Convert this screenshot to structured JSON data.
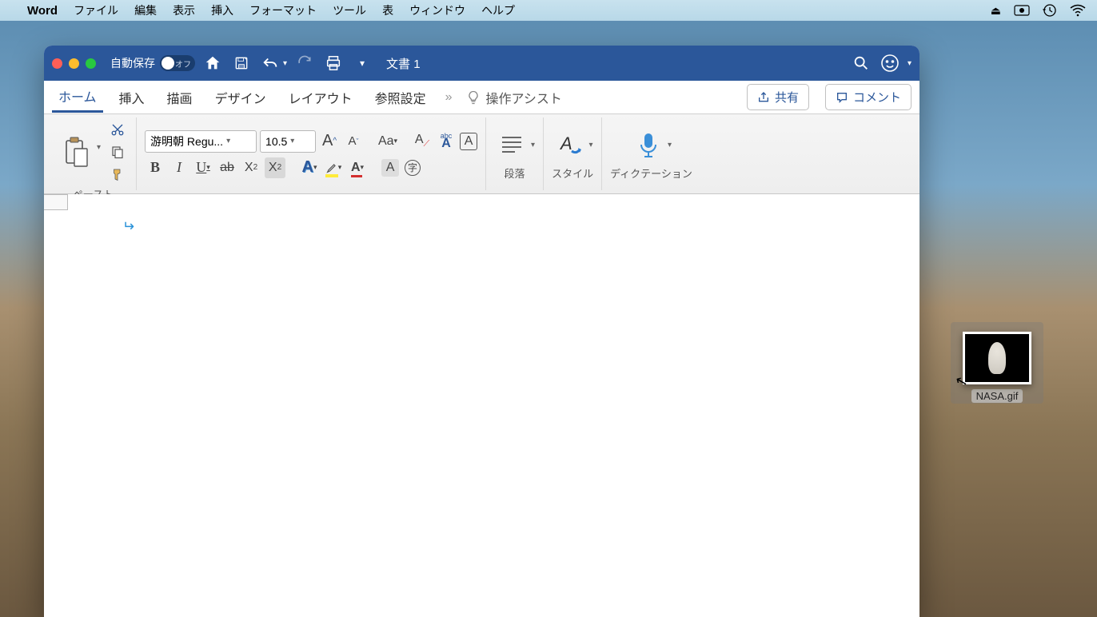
{
  "menubar": {
    "app_name": "Word",
    "items": [
      "ファイル",
      "編集",
      "表示",
      "挿入",
      "フォーマット",
      "ツール",
      "表",
      "ウィンドウ",
      "ヘルプ"
    ]
  },
  "titlebar": {
    "autosave_label": "自動保存",
    "autosave_state": "オフ",
    "document_title": "文書 1"
  },
  "tabs": {
    "items": [
      "ホーム",
      "挿入",
      "描画",
      "デザイン",
      "レイアウト",
      "参照設定"
    ],
    "active_index": 0,
    "assist_label": "操作アシスト",
    "share_label": "共有",
    "comment_label": "コメント"
  },
  "ribbon": {
    "paste_label": "ペースト",
    "font_name": "游明朝 Regu...",
    "font_size": "10.5",
    "paragraph_label": "段落",
    "style_label": "スタイル",
    "dictation_label": "ディクテーション"
  },
  "desktop": {
    "file_name": "NASA.gif"
  }
}
